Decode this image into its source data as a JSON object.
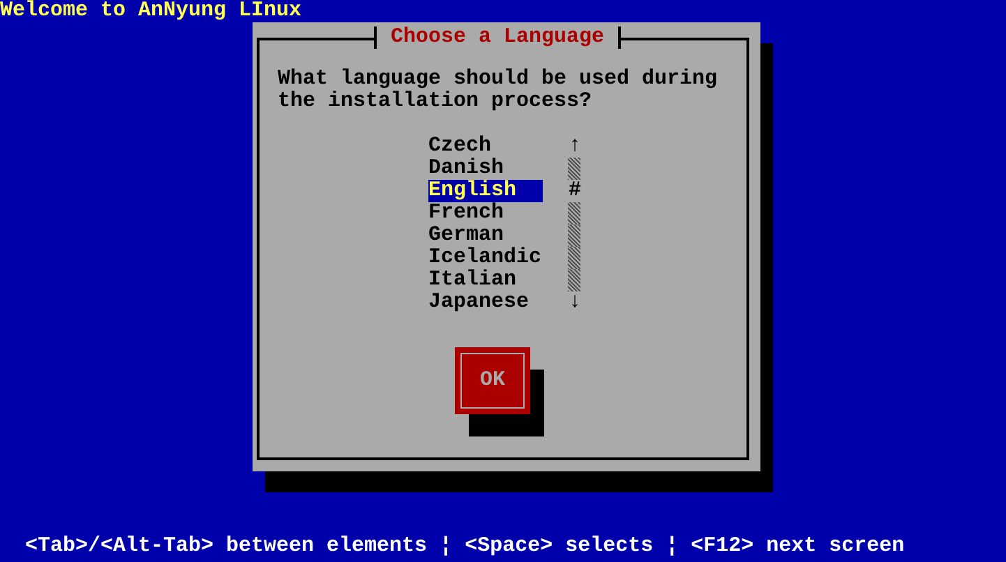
{
  "title": "Welcome to AnNyung LInux",
  "dialog": {
    "title": "Choose a Language",
    "prompt": "What language should be used during the installation process?",
    "languages": [
      {
        "label": "Czech",
        "selected": false
      },
      {
        "label": "Danish",
        "selected": false
      },
      {
        "label": "English",
        "selected": true
      },
      {
        "label": "French",
        "selected": false
      },
      {
        "label": "German",
        "selected": false
      },
      {
        "label": "Icelandic",
        "selected": false
      },
      {
        "label": "Italian",
        "selected": false
      },
      {
        "label": "Japanese",
        "selected": false
      }
    ],
    "scrollbar": {
      "up": "↑",
      "thumb": "#",
      "down": "↓"
    },
    "button": "OK"
  },
  "status_bar": {
    "separator": "¦",
    "hints": [
      "<Tab>/<Alt-Tab> between elements",
      "<Space> selects",
      "<F12> next screen"
    ]
  }
}
